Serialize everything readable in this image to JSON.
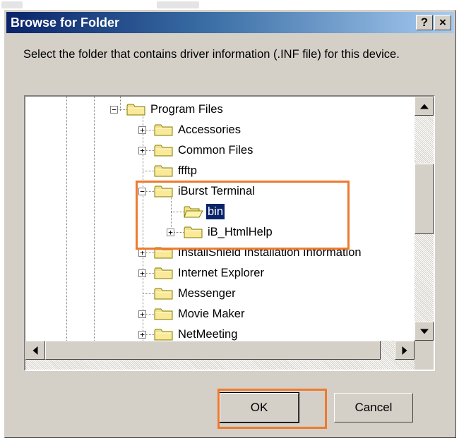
{
  "dialog": {
    "title": "Browse for Folder",
    "help_label": "?",
    "close_label": "×",
    "prompt": "Select the folder that contains driver information (.INF file) for this device."
  },
  "tree": {
    "items": [
      {
        "label": "Program Files",
        "expander": "-"
      },
      {
        "label": "Accessories",
        "expander": "+"
      },
      {
        "label": "Common Files",
        "expander": "+"
      },
      {
        "label": "ffftp",
        "expander": ""
      },
      {
        "label": "iBurst Terminal",
        "expander": "-"
      },
      {
        "label": "bin",
        "expander": "",
        "selected": true,
        "open": true
      },
      {
        "label": "iB_HtmlHelp",
        "expander": "+"
      },
      {
        "label": "InstallShield Installation Information",
        "expander": "+"
      },
      {
        "label": "Internet Explorer",
        "expander": "+"
      },
      {
        "label": "Messenger",
        "expander": ""
      },
      {
        "label": "Movie Maker",
        "expander": "+"
      },
      {
        "label": "NetMeeting",
        "expander": "+"
      }
    ]
  },
  "buttons": {
    "ok": "OK",
    "cancel": "Cancel"
  },
  "icons": {
    "folder": "folder-icon",
    "folder_open": "folder-open-icon",
    "scroll_up": "arrow-up-icon",
    "scroll_down": "arrow-down-icon",
    "scroll_left": "arrow-left-icon",
    "scroll_right": "arrow-right-icon"
  },
  "colors": {
    "highlight": "#ef7a2f",
    "selection": "#0a246a",
    "folder": "#f5e08e"
  }
}
